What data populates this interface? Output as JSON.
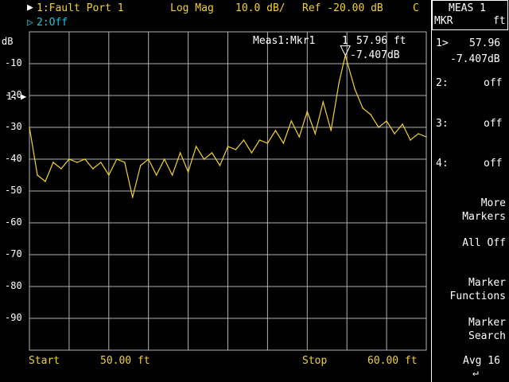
{
  "header": {
    "trace1": "1:Fault Port 1",
    "format": "Log Mag",
    "scale": "10.0 dB/",
    "ref": "Ref -20.00 dB",
    "cal": "C",
    "trace2": "2:Off"
  },
  "axis": {
    "unit": "dB",
    "ref_marker": "1:",
    "y_ticks": [
      "-10",
      "-20",
      "-30",
      "-40",
      "-50",
      "-60",
      "-70",
      "-80",
      "-90"
    ],
    "start_label": "Start",
    "start_value": "50.00 ft",
    "stop_label": "Stop",
    "stop_value": "60.00 ft"
  },
  "marker_readout": {
    "name": "Meas1:Mkr1",
    "num": "1",
    "x": "57.96 ft",
    "y": "-7.407dB"
  },
  "menu": {
    "title1": "MEAS 1",
    "title2_left": "MKR",
    "title2_right": "ft",
    "m1_label": "1>",
    "m1_x": "57.96",
    "m1_y": "-7.407dB",
    "m2_label": "2:",
    "m2_val": "off",
    "m3_label": "3:",
    "m3_val": "off",
    "m4_label": "4:",
    "m4_val": "off",
    "more1": "More",
    "more2": "Markers",
    "alloff": "All Off",
    "mf1": "Marker",
    "mf2": "Functions",
    "ms1": "Marker",
    "ms2": "Search",
    "avg": "Avg 16"
  },
  "colors": {
    "trace": "#f2d230",
    "grid": "#b4b4b4",
    "trace2": "#20c8d8"
  },
  "chart_data": {
    "type": "line",
    "xlim": [
      50.0,
      60.0
    ],
    "ylim": [
      -100,
      0
    ],
    "x": [
      50.0,
      50.2,
      50.4,
      50.6,
      50.8,
      51.0,
      51.2,
      51.4,
      51.6,
      51.8,
      52.0,
      52.2,
      52.4,
      52.6,
      52.8,
      53.0,
      53.2,
      53.4,
      53.6,
      53.8,
      54.0,
      54.2,
      54.4,
      54.6,
      54.8,
      55.0,
      55.2,
      55.4,
      55.6,
      55.8,
      56.0,
      56.2,
      56.4,
      56.6,
      56.8,
      57.0,
      57.2,
      57.4,
      57.6,
      57.8,
      57.96,
      58.2,
      58.4,
      58.6,
      58.8,
      59.0,
      59.2,
      59.4,
      59.6,
      59.8,
      60.0
    ],
    "y": [
      -30,
      -45,
      -47,
      -41,
      -43,
      -40,
      -41,
      -40,
      -43,
      -41,
      -45,
      -40,
      -41,
      -52,
      -42,
      -40,
      -45,
      -40,
      -45,
      -38,
      -44,
      -36,
      -40,
      -38,
      -42,
      -36,
      -37,
      -34,
      -38,
      -34,
      -35,
      -31,
      -35,
      -28,
      -33,
      -25,
      -32,
      -22,
      -31,
      -16,
      -7.4,
      -18,
      -24,
      -26,
      -30,
      -28,
      -32,
      -29,
      -34,
      -32,
      -33
    ]
  }
}
